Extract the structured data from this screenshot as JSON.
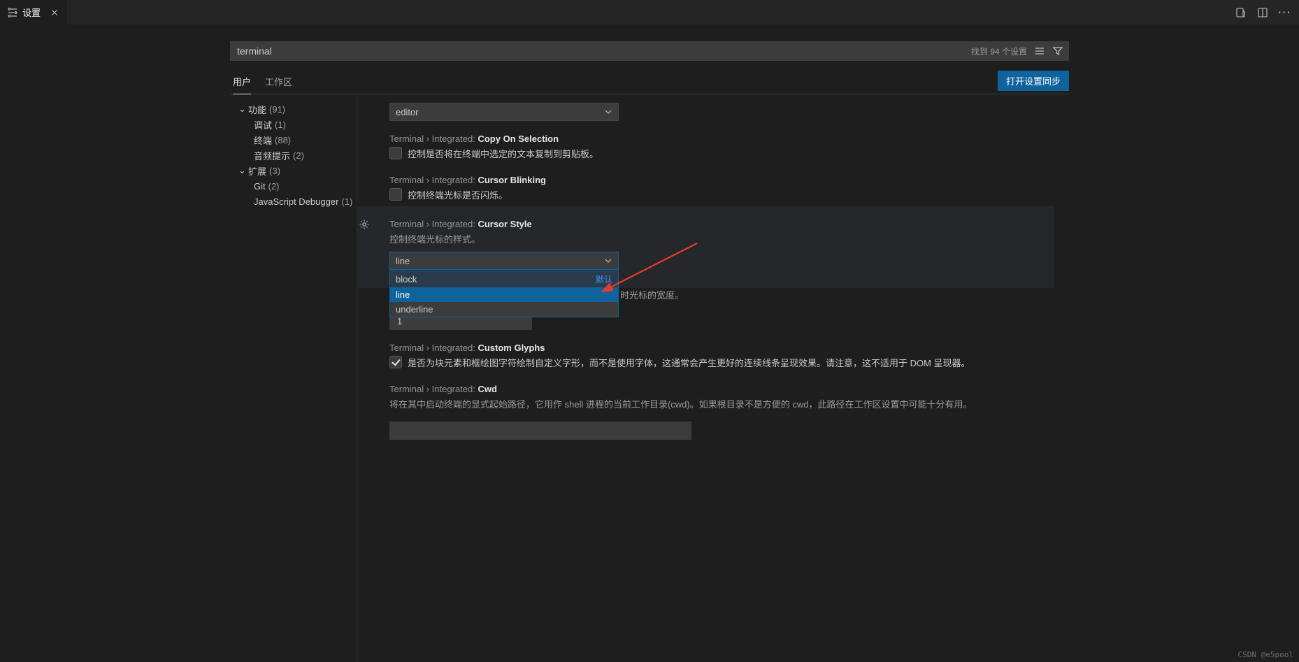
{
  "tab": {
    "title": "设置"
  },
  "search": {
    "value": "terminal",
    "result_count_label": "找到 94 个设置"
  },
  "scope_tabs": {
    "user": "用户",
    "workspace": "工作区"
  },
  "sync_button": "打开设置同步",
  "tree": {
    "feature": {
      "label": "功能",
      "count": "(91)"
    },
    "debug": {
      "label": "调试",
      "count": "(1)"
    },
    "terminal": {
      "label": "终端",
      "count": "(88)"
    },
    "audio": {
      "label": "音频提示",
      "count": "(2)"
    },
    "ext": {
      "label": "扩展",
      "count": "(3)"
    },
    "git": {
      "label": "Git",
      "count": "(2)"
    },
    "jsdbg": {
      "label": "JavaScript Debugger",
      "count": "(1)"
    }
  },
  "top_select": {
    "value": "editor"
  },
  "copy_on_selection": {
    "crumb": "Terminal › Integrated: ",
    "name": "Copy On Selection",
    "desc": "控制是否将在终端中选定的文本复制到剪贴板。"
  },
  "cursor_blinking": {
    "crumb": "Terminal › Integrated: ",
    "name": "Cursor Blinking",
    "desc": "控制终端光标是否闪烁。"
  },
  "cursor_style": {
    "crumb": "Terminal › Integrated: ",
    "name": "Cursor Style",
    "desc": "控制终端光标的样式。",
    "value": "line",
    "options": {
      "block": "block",
      "line": "line",
      "underline": "underline"
    },
    "default_label": "默认"
  },
  "cursor_width": {
    "suffix_desc": "时光标的宽度。",
    "value": "1"
  },
  "custom_glyphs": {
    "crumb": "Terminal › Integrated: ",
    "name": "Custom Glyphs",
    "desc": "是否为块元素和框绘图字符绘制自定义字形，而不是使用字体，这通常会产生更好的连续线条呈现效果。请注意，这不适用于 DOM 呈现器。"
  },
  "cwd": {
    "crumb": "Terminal › Integrated: ",
    "name": "Cwd",
    "desc": "将在其中启动终端的显式起始路径，它用作 shell 进程的当前工作目录(cwd)。如果根目录不是方便的 cwd，此路径在工作区设置中可能十分有用。",
    "value": ""
  },
  "watermark": "CSDN @e5pool"
}
